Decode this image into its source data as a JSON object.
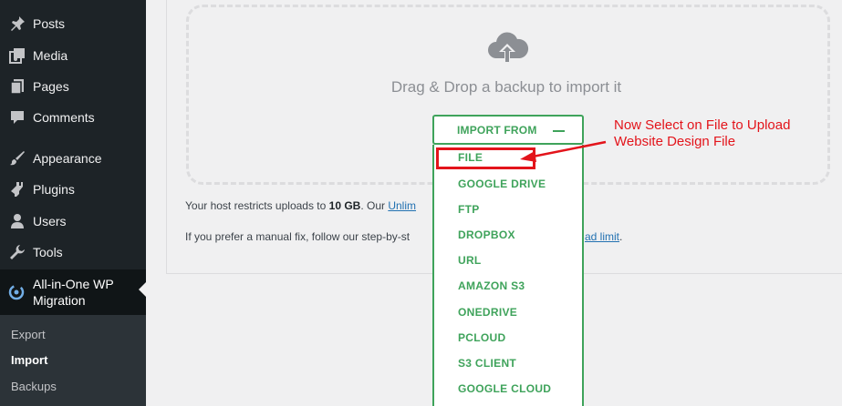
{
  "sidebar": {
    "items": [
      {
        "label": "Posts",
        "icon": "pin-icon"
      },
      {
        "label": "Media",
        "icon": "media-icon"
      },
      {
        "label": "Pages",
        "icon": "pages-icon"
      },
      {
        "label": "Comments",
        "icon": "comment-icon"
      },
      {
        "label": "Appearance",
        "icon": "brush-icon"
      },
      {
        "label": "Plugins",
        "icon": "plugin-icon"
      },
      {
        "label": "Users",
        "icon": "user-icon"
      },
      {
        "label": "Tools",
        "icon": "wrench-icon"
      }
    ],
    "active": {
      "line1": "All-in-One WP",
      "line2": "Migration",
      "icon": "migration-icon"
    },
    "submenu": [
      {
        "label": "Export"
      },
      {
        "label": "Import"
      },
      {
        "label": "Backups"
      }
    ]
  },
  "main": {
    "drag_text": "Drag & Drop a backup to import it",
    "host_prefix": "Your host restricts uploads to ",
    "host_size": "10 GB",
    "host_mid": ". Our ",
    "host_link": "Unlim",
    "manual_prefix": "If you prefer a manual fix, follow our step-by-st",
    "manual_link": "ad limit",
    "manual_end": "."
  },
  "import": {
    "button_label": "IMPORT FROM",
    "options": [
      "FILE",
      "GOOGLE DRIVE",
      "FTP",
      "DROPBOX",
      "URL",
      "AMAZON S3",
      "ONEDRIVE",
      "PCLOUD",
      "S3 CLIENT",
      "GOOGLE CLOUD"
    ]
  },
  "annotation": {
    "line1": "Now Select on File to Upload",
    "line2": "Website Design File"
  },
  "colors": {
    "sidebar_bg": "#1d2327",
    "accent_green": "#3fa35b",
    "annotation_red": "#e3141b",
    "link_blue": "#2271b1"
  }
}
